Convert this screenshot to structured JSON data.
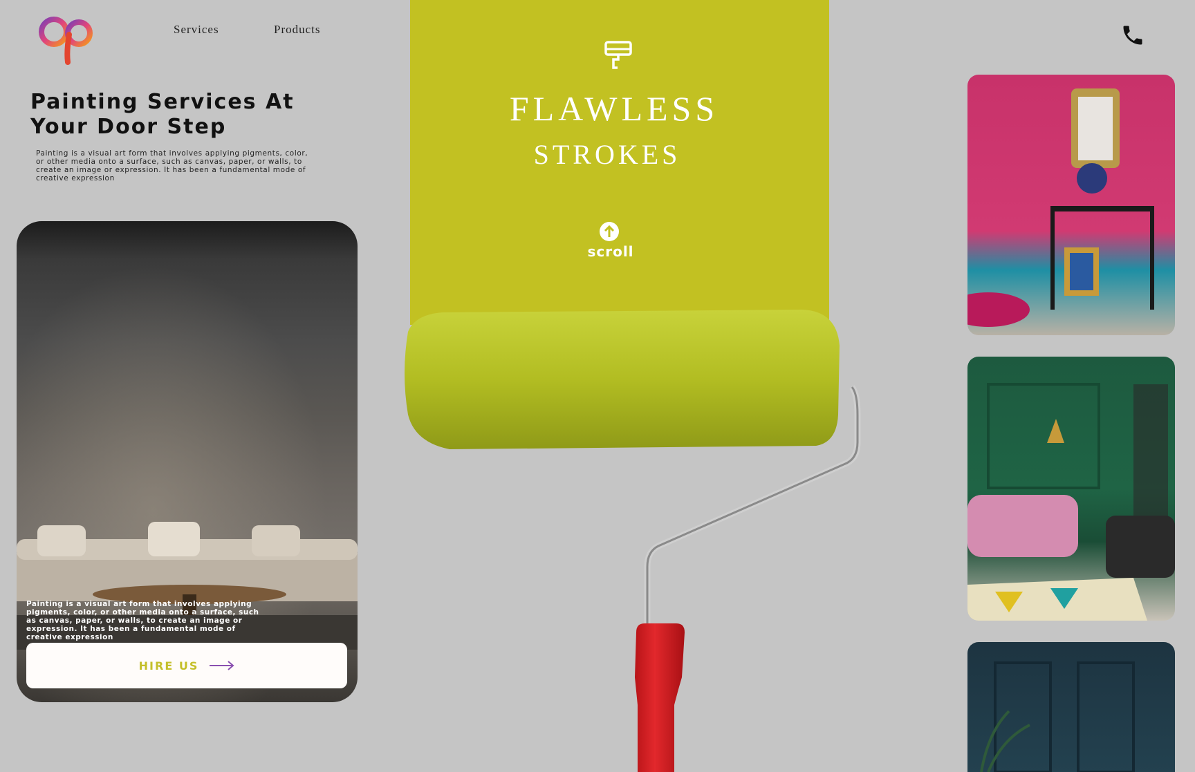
{
  "header": {
    "logo_text": "ap",
    "nav": [
      {
        "label": "Services"
      },
      {
        "label": "Products"
      }
    ],
    "phone_icon": "phone-icon"
  },
  "hero": {
    "title": "Painting Services At Your Door Step",
    "description": "Painting is a visual art form that involves applying pigments, color, or other media onto a surface, such as canvas, paper, or walls, to create an image or expression. It has been a fundamental mode of creative expression"
  },
  "card": {
    "caption": "Painting is a visual art form that involves applying pigments, color, or other media onto a surface, such as canvas, paper, or walls, to create an image or expression. It has been a fundamental mode of creative expression",
    "button_label": "HIRE US"
  },
  "center": {
    "title_line1": "FLAWLESS",
    "title_line2": "STROKES",
    "scroll_label": "scroll",
    "icons": [
      "paint-brush-icon",
      "scroll-up-icon",
      "arrow-right-icon"
    ]
  },
  "colors": {
    "background": "#c5c5c5",
    "accent": "#c2c122",
    "button_text": "#c4bf2a",
    "arrow": "#8a4fb0",
    "roller_handle": "#d8262a"
  }
}
